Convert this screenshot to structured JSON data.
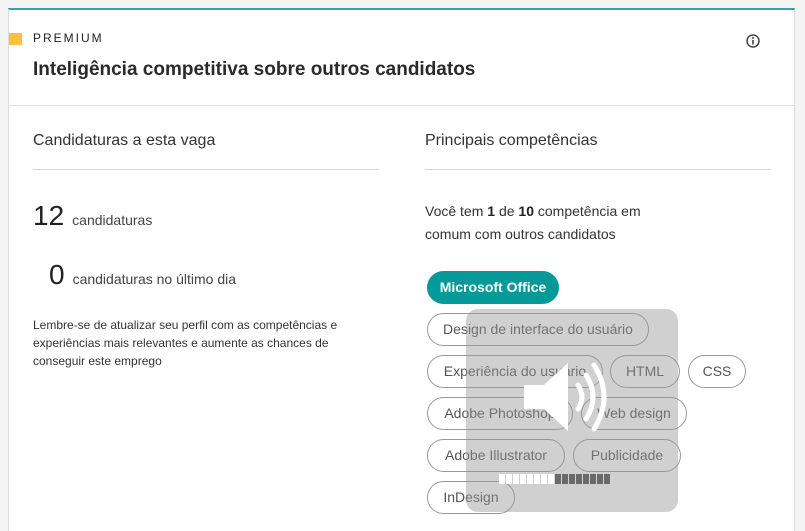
{
  "header": {
    "premium_label": "PREMIUM",
    "title": "Inteligência competitiva sobre outros candidatos",
    "info_icon": "info-icon"
  },
  "applications": {
    "title": "Candidaturas a esta vaga",
    "total_count": "12",
    "total_label": "candidaturas",
    "last_day_count": "0",
    "last_day_label": "candidaturas no último dia",
    "note": "Lembre-se de atualizar seu perfil com as competências e experiências mais relevantes e aumente as chances de conseguir este emprego"
  },
  "skills": {
    "title": "Principais competências",
    "summary_prefix": "Você tem",
    "summary_have": "1",
    "summary_of": "de",
    "summary_total": "10",
    "summary_suffix_1": "competência em",
    "summary_suffix_2": "comum com outros candidatos",
    "tags": [
      {
        "label": "Microsoft Office",
        "active": true
      },
      {
        "label": "Design de interface do usuário",
        "active": false
      },
      {
        "label": "Experiência do usuário",
        "active": false
      },
      {
        "label": "HTML",
        "active": false
      },
      {
        "label": "CSS",
        "active": false
      },
      {
        "label": "Adobe Photoshop",
        "active": false
      },
      {
        "label": "Web design",
        "active": false
      },
      {
        "label": "Adobe Illustrator",
        "active": false
      },
      {
        "label": "Publicidade",
        "active": false
      },
      {
        "label": "InDesign",
        "active": false
      }
    ]
  },
  "volume_overlay": {
    "icon": "speaker-volume-icon",
    "level": 0.5,
    "segments_total": 16,
    "segments_on": 8
  },
  "colors": {
    "accent": "#06999a",
    "premium": "#f5c344",
    "top_border": "#2ea8a8"
  }
}
